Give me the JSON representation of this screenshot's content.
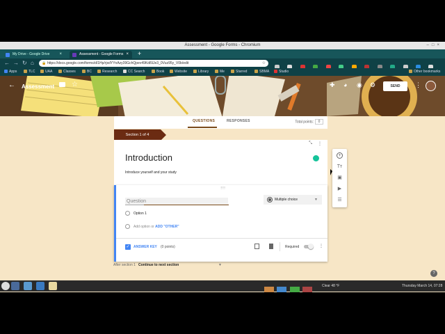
{
  "window": {
    "title": "Assessment - Google Forms - Chromium"
  },
  "tabs": [
    {
      "label": "My Drive - Google Drive",
      "color": "#4285f4"
    },
    {
      "label": "Assessment - Google Forms",
      "color": "#673ab7"
    }
  ],
  "address": {
    "url": "https://docs.google.com/forms/d/1Hp/rjxdYYnAzy39GchQpev49Kdi5lJe3_0Vuz95y_V0b/edit"
  },
  "bookmarks": [
    "Apps",
    "TLC",
    "UAA",
    "Classes",
    "BC",
    "Research",
    "CC Search",
    "Book",
    "Website",
    "Library",
    "Me",
    "Starred",
    "SBMA",
    "Studio",
    "Other bookmarks"
  ],
  "form": {
    "title": "Assessment",
    "send_label": "SEND",
    "tab_questions": "QUESTIONS",
    "tab_responses": "RESPONSES",
    "total_points_label": "Total points:",
    "total_points_value": "0",
    "section_label": "Section 1 of 4",
    "section_title": "Introduction",
    "section_description": "Introduce yourself and your study",
    "question_placeholder": "Question",
    "question_type": "Multiple choice",
    "option1": "Option 1",
    "add_option": "Add option",
    "or": "or",
    "add_other": "ADD \"OTHER\"",
    "answer_key": "ANSWER KEY",
    "points": "(0 points)",
    "required": "Required",
    "after_section": "After section 1",
    "continue": "Continue to next section"
  },
  "taskbar": {
    "weather": "Clear 48 °F",
    "clock": "Thursday March 14, 07:28"
  }
}
